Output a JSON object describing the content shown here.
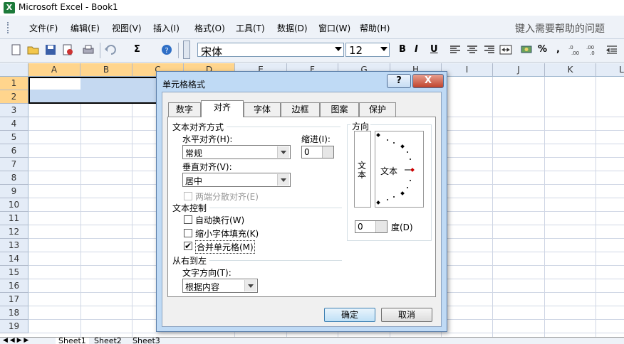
{
  "window": {
    "title": "Microsoft Excel - Book1",
    "icon": "excel-icon"
  },
  "menu": [
    {
      "label": "文件(F)"
    },
    {
      "label": "编辑(E)"
    },
    {
      "label": "视图(V)"
    },
    {
      "label": "插入(I)"
    },
    {
      "label": "格式(O)"
    },
    {
      "label": "工具(T)"
    },
    {
      "label": "数据(D)"
    },
    {
      "label": "窗口(W)"
    },
    {
      "label": "帮助(H)"
    }
  ],
  "help_search": {
    "placeholder": "键入需要帮助的问题"
  },
  "toolbar": {
    "font_name": "宋体",
    "font_size": "12",
    "sigma_label": "Σ",
    "bold": "B",
    "italic": "I",
    "underline": "U",
    "percent": "%",
    "comma": ","
  },
  "grid": {
    "columns": [
      "A",
      "B",
      "C",
      "D",
      "E",
      "F",
      "G",
      "H",
      "I",
      "J",
      "K",
      "L"
    ],
    "rows": [
      "1",
      "2",
      "3",
      "4",
      "5",
      "6",
      "7",
      "8",
      "9",
      "10",
      "11",
      "12",
      "13",
      "14",
      "15",
      "16",
      "17",
      "18",
      "19"
    ]
  },
  "sheet_tabs": [
    "Sheet1",
    "Sheet2",
    "Sheet3"
  ],
  "dialog": {
    "title": "单元格格式",
    "help_button": "?",
    "close_button": "X",
    "tabs": [
      "数字",
      "对齐",
      "字体",
      "边框",
      "图案",
      "保护"
    ],
    "active_tab": "对齐",
    "text_alignment": {
      "group_label": "文本对齐方式",
      "horizontal_label": "水平对齐(H):",
      "horizontal_value": "常规",
      "indent_label": "缩进(I):",
      "indent_value": "0",
      "vertical_label": "垂直对齐(V):",
      "vertical_value": "居中",
      "justify_distributed_label": "两端分散对齐(E)"
    },
    "text_control": {
      "group_label": "文本控制",
      "wrap_text_label": "自动换行(W)",
      "shrink_to_fit_label": "缩小字体填充(K)",
      "merge_cells_label": "合并单元格(M)",
      "merge_cells_checked": true
    },
    "rtl": {
      "group_label": "从右到左",
      "direction_label": "文字方向(T):",
      "direction_value": "根据内容"
    },
    "orientation": {
      "group_label": "方向",
      "vertical_text": "文本",
      "horizontal_text": "文本",
      "degrees_value": "0",
      "degrees_label": "度(D)"
    },
    "ok_button": "确定",
    "cancel_button": "取消"
  }
}
